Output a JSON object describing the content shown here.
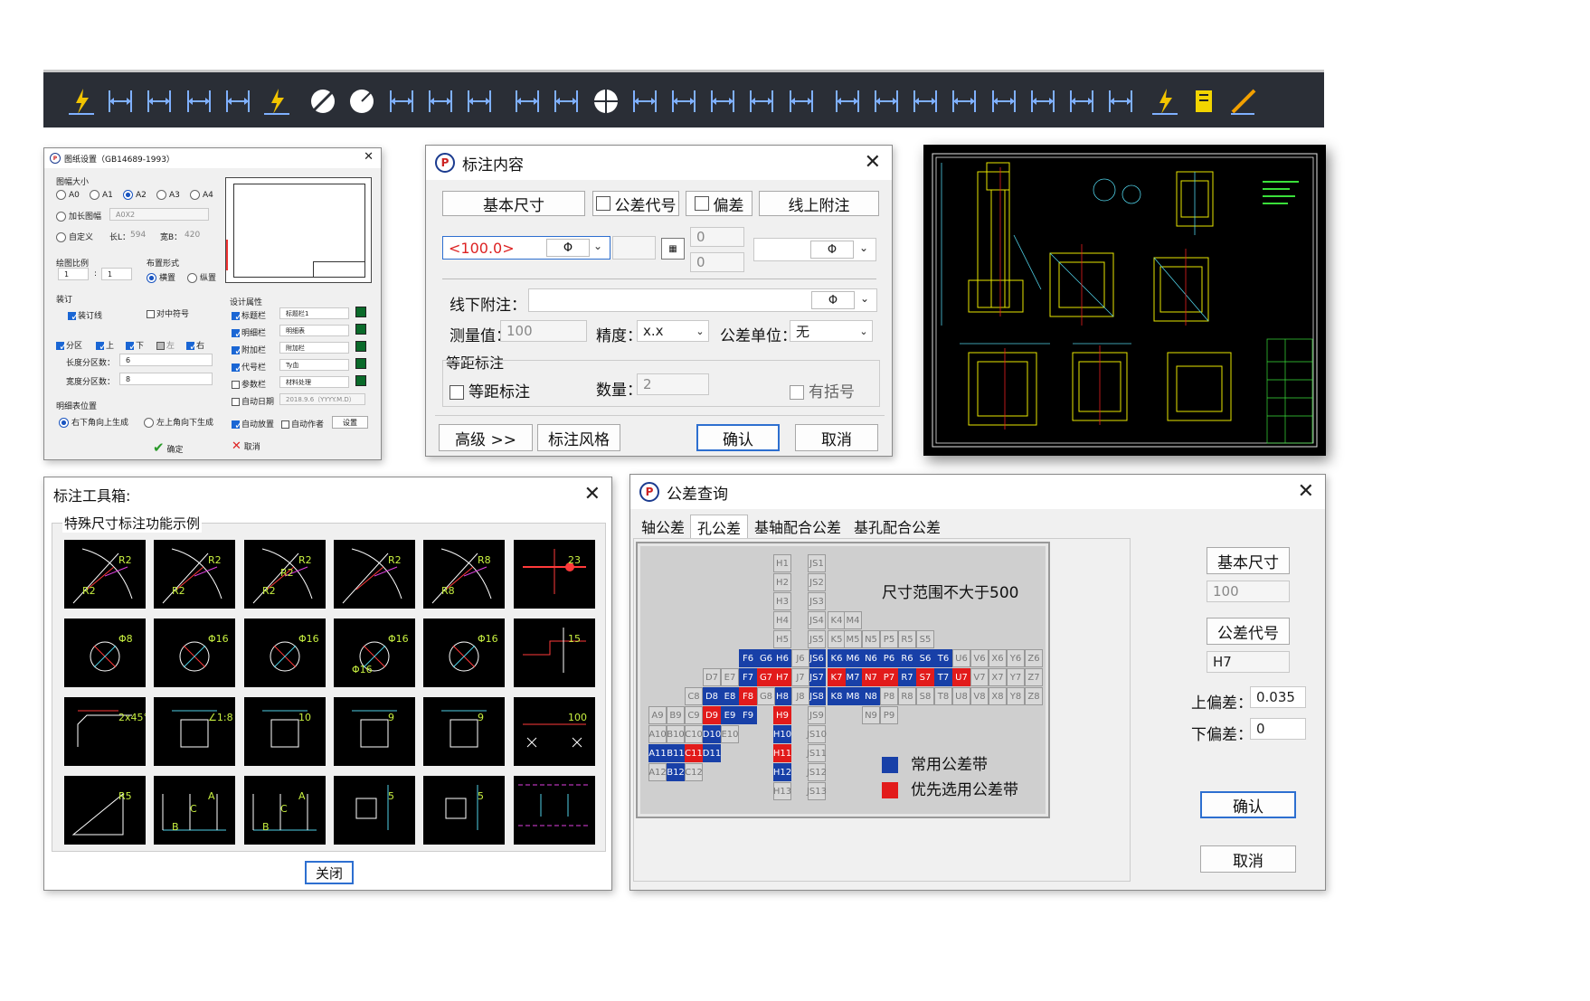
{
  "toolbar": {
    "icons": [
      "lightning-dim-icon",
      "aligned-dim-icon",
      "linear-dim-icon",
      "vertical-dim-icon",
      "angled-dim-icon",
      "lightning-ortho-icon",
      "diameter-icon",
      "radius-icon",
      "arc-length-icon",
      "leader-icon",
      "arc-dim-icon",
      "baseline-dim-icon",
      "continue-dim-icon",
      "center-mark-icon",
      "angle-dim-icon",
      "hole-note-icon",
      "surface-finish-icon",
      "tolerance-note-icon",
      "chain-dim-icon",
      "stack-dim-icon",
      "diameter-note-icon",
      "symmetric-dim-icon",
      "datum-icon",
      "position-tol-icon",
      "taper-icon",
      "curve-dim-icon",
      "rotate-dim-icon",
      "quick-dim-icon",
      "bom-icon",
      "edit-icon"
    ]
  },
  "sheet": {
    "title": "图纸设置（GB14689-1993）",
    "size_label": "图幅大小",
    "sizes": [
      "A0",
      "A1",
      "A2",
      "A3",
      "A4"
    ],
    "selected_size": "A2",
    "extend_label": "加长图幅",
    "extend_value": "A0X2",
    "custom_label": "自定义",
    "len_label": "长L：",
    "len_value": "594",
    "width_label": "宽B：",
    "width_value": "420",
    "scale_label": "绘图比例",
    "scale_a": "1",
    "scale_b": "1",
    "layout_label": "布置形式",
    "layout_h": "横置",
    "layout_v": "纵置",
    "binding_label": "装订",
    "binding_line": "装订线",
    "center_mark": "对中符号",
    "zone": "分区",
    "top": "上",
    "bottom": "下",
    "left": "左",
    "right": "右",
    "len_zone_label": "长度分区数：",
    "len_zone_value": "6",
    "wid_zone_label": "宽度分区数：",
    "wid_zone_value": "8",
    "list_pos_label": "明细表位置",
    "list_pos_a": "右下角向上生成",
    "list_pos_b": "左上角向下生成",
    "design_label": "设计属性",
    "props": [
      {
        "label": "标题栏",
        "value": "标题栏1"
      },
      {
        "label": "明细栏",
        "value": "明细表"
      },
      {
        "label": "附加栏",
        "value": "附加栏"
      },
      {
        "label": "代号栏",
        "value": "Ty血"
      },
      {
        "label": "参数栏",
        "value": "材料处理"
      },
      {
        "label": "自动日期",
        "value": "2018.9.6（YYYY.M.D）"
      }
    ],
    "auto_place": "自动放置",
    "auto_author": "自动作者",
    "settings": "设置",
    "ok": "确定",
    "cancel": "取消"
  },
  "content": {
    "title": "标注内容",
    "tab_basic": "基本尺寸",
    "tab_tolcode": "公差代号",
    "tab_dev": "偏差",
    "tab_above": "线上附注",
    "basic_value": "<100.0>",
    "phi": "Φ",
    "dev_upper": "0",
    "dev_lower": "0",
    "below_label": "线下附注：",
    "measure_label": "测量值：",
    "measure_value": "100",
    "precision_label": "精度：",
    "precision_value": "x.x",
    "unit_label": "公差单位：",
    "unit_value": "无",
    "equal_group": "等距标注",
    "equal_label": "等距标注",
    "count_label": "数量：",
    "count_value": "2",
    "bracket_label": "有括号",
    "btn_adv": "高级 >>",
    "btn_style": "标注风格",
    "btn_ok": "确认",
    "btn_cancel": "取消"
  },
  "toolbox": {
    "title": "标注工具箱:",
    "group": "特殊尺寸标注功能示例",
    "close": "关闭",
    "labels": {
      "r1": [
        "R2",
        "R2"
      ],
      "r2": [
        "R2",
        "R2"
      ],
      "r3": [
        "R2",
        "R2",
        "R2"
      ],
      "r4": [
        "R2"
      ],
      "r5": [
        "R8",
        "R8"
      ],
      "r6": [
        "23"
      ],
      "c1": [
        "Φ8"
      ],
      "c2": [
        "Φ16"
      ],
      "c3": [
        "Φ16"
      ],
      "c4": [
        "Φ16",
        "Φ16"
      ],
      "c5": [
        "Φ16"
      ],
      "c6": [
        "15"
      ],
      "m1": [
        "2x45°"
      ],
      "m2": [
        "∠1:8"
      ],
      "m3": [
        "10"
      ],
      "m4": [
        "9"
      ],
      "m5": [
        "9"
      ],
      "m6": [
        "100"
      ],
      "n1": [
        "R5"
      ],
      "n2": [
        "A",
        "B",
        "C"
      ],
      "n3": [
        "A",
        "B",
        "C"
      ],
      "n4": [
        "5"
      ],
      "n5": [
        "5"
      ],
      "n6": []
    }
  },
  "tolerance": {
    "title": "公差查询",
    "tabs": [
      "轴公差",
      "孔公差",
      "基轴配合公差",
      "基孔配合公差"
    ],
    "active_tab": "孔公差",
    "range_note": "尺寸范围不大于500",
    "legend_common": "常用公差带",
    "legend_preferred": "优先选用公差带",
    "basic_label": "基本尺寸",
    "basic_value": "100",
    "code_label": "公差代号",
    "code_value": "H7",
    "upper_label": "上偏差：",
    "upper_value": "0.035",
    "lower_label": "下偏差：",
    "lower_value": "0",
    "btn_ok": "确认",
    "btn_cancel": "取消",
    "colors": {
      "common": "#1840a8",
      "preferred": "#e21b1b"
    }
  }
}
